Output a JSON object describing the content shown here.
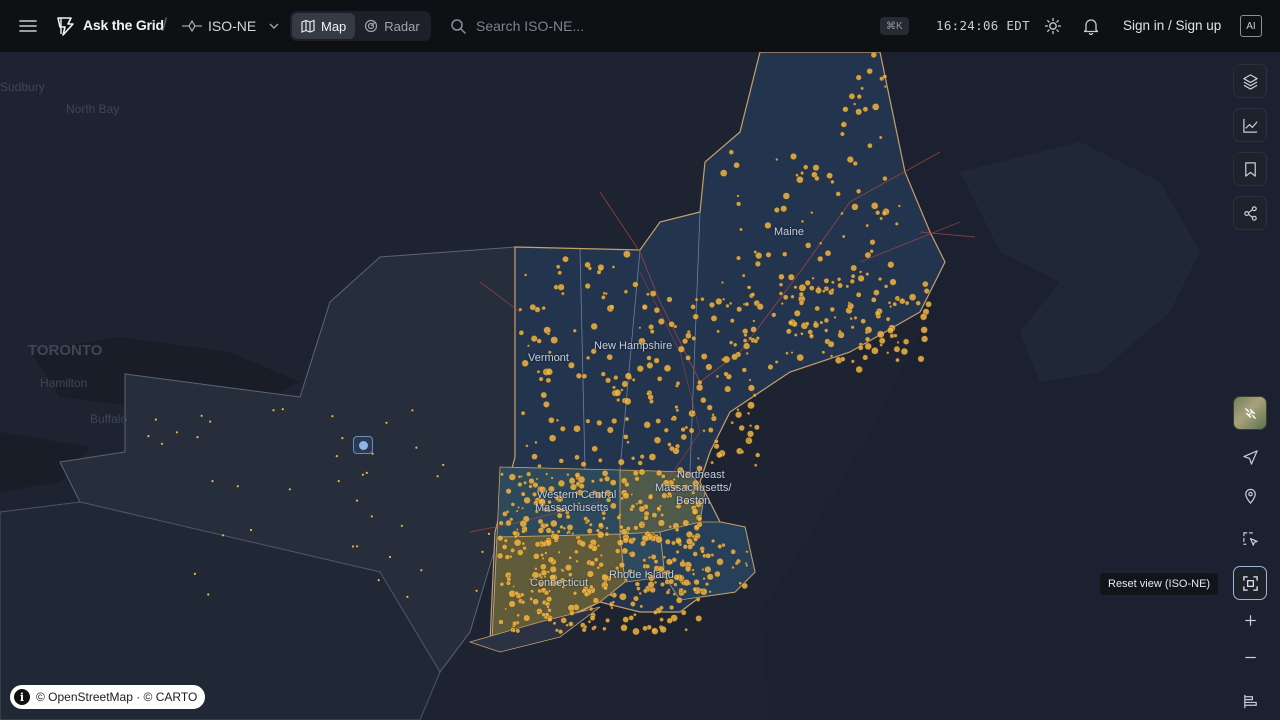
{
  "header": {
    "brand": "Ask the Grid",
    "region": "ISO-NE",
    "modes": [
      {
        "label": "Map",
        "active": true
      },
      {
        "label": "Radar",
        "active": false
      }
    ],
    "search_placeholder": "Search ISO-NE...",
    "shortcut": "⌘K",
    "time": "16:24:06 EDT",
    "signin": "Sign in / Sign up",
    "ai_label": "AI"
  },
  "map": {
    "state_labels": [
      "Maine",
      "New Hampshire",
      "Vermont",
      "Western Central Massachusetts",
      "Northeast Massachusetts / Boston",
      "Connecticut",
      "Rhode Island"
    ],
    "state_label_text": {
      "maine": "Maine",
      "new_hampshire": "New Hampshire",
      "vermont": "Vermont",
      "wcma_1": "Western Central",
      "wcma_2": "Massachusetts",
      "nema_1": "Northeast",
      "nema_2": "Massachusetts/",
      "nema_3": "Boston",
      "ct": "Connecticut",
      "ri": "Rhode Island"
    },
    "base_labels": {
      "toronto": "TORONTO",
      "hamilton": "Hamilton",
      "buffalo": "Buffalo",
      "north_bay": "North Bay",
      "sudbury": "Sudbury"
    },
    "tooltip": "Reset view (ISO-NE)",
    "attribution": "© OpenStreetMap · © CARTO"
  },
  "colors": {
    "plant_dot": "#f0b545",
    "ct_fill": "#6b6437",
    "new_england_fill": "#22344e",
    "boundary": "#c7a06b"
  },
  "icons": {
    "layers": "layers-icon",
    "chart": "chart-icon",
    "bookmark": "bookmark-icon",
    "share": "share-icon",
    "satellite": "satellite-icon",
    "navigate": "navigate-icon",
    "pin": "pin-icon",
    "select": "select-icon",
    "reset": "reset-view-icon",
    "zoom_in": "zoom-in-icon",
    "zoom_out": "zoom-out-icon",
    "legend": "legend-icon"
  }
}
